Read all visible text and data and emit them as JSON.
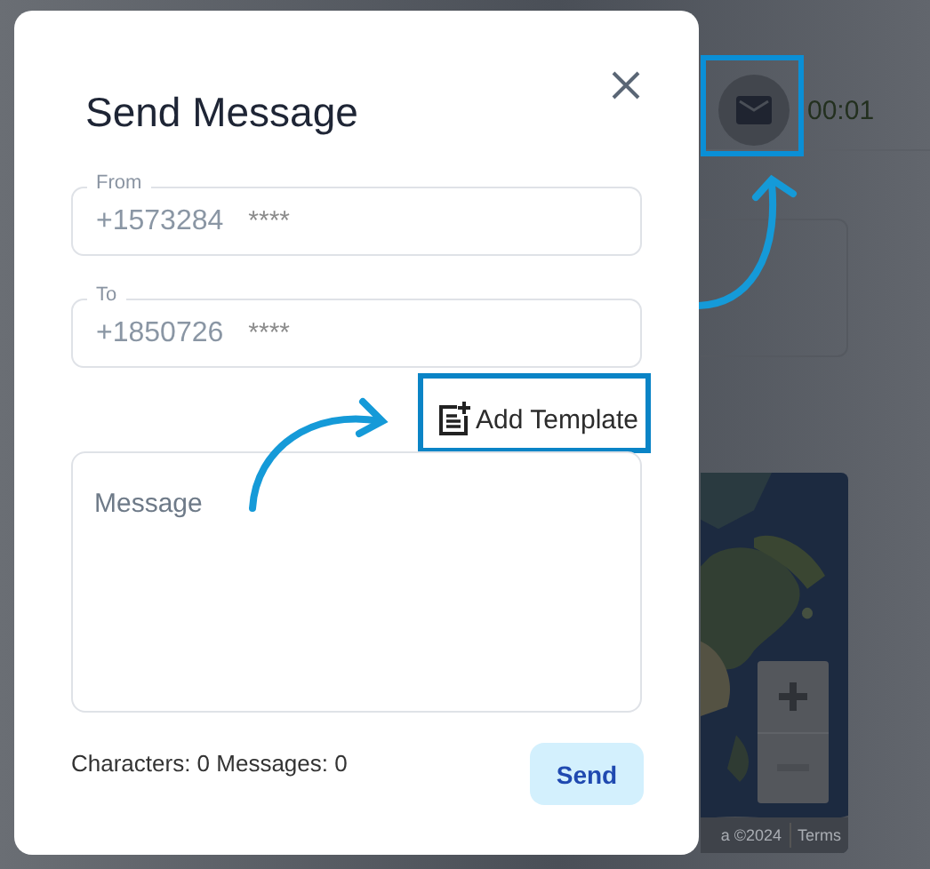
{
  "background": {
    "timer": "00:01",
    "map": {
      "kind": "picture",
      "attribution": "a ©2024",
      "terms": "Terms"
    }
  },
  "dialog": {
    "title": "Send Message",
    "fields": [
      {
        "label": "From",
        "value": "+1573284",
        "masked": "****"
      },
      {
        "label": "To",
        "value": "+1850726",
        "masked": "****"
      }
    ],
    "add_template": "Add Template",
    "message": {
      "placeholder": "Message"
    },
    "counter": "Characters: 0 Messages: 0",
    "send": "Send"
  }
}
